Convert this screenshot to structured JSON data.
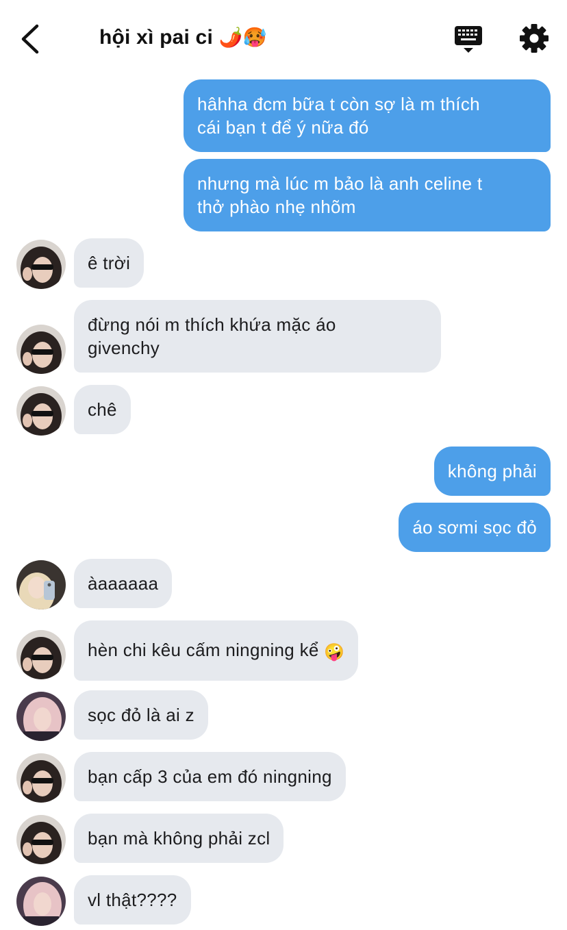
{
  "header": {
    "title": "hội xì pai ci",
    "title_emoji_1": "🌶️",
    "title_emoji_2": "🥵",
    "back_icon": "chevron-left-icon",
    "keyboard_icon": "keyboard-icon",
    "settings_icon": "gear-icon"
  },
  "colors": {
    "outgoing_bubble": "#4d9fe9",
    "incoming_bubble": "#e6e9ee",
    "header_text": "#111111"
  },
  "messages": [
    {
      "direction": "out",
      "lines": [
        "hâhha đcm bữa t còn sợ là m thích",
        "cái bạn t để ý nữa đó"
      ]
    },
    {
      "direction": "out",
      "lines": [
        "nhưng mà lúc m bảo là anh celine t",
        "thở phào nhẹ nhõm"
      ]
    },
    {
      "direction": "in",
      "avatar": "avatar-dark-hair-sunglasses",
      "lines": [
        "ê trời"
      ]
    },
    {
      "direction": "in",
      "avatar": "avatar-dark-hair-sunglasses",
      "lines": [
        "đừng nói m thích khứa mặc áo",
        "givenchy"
      ]
    },
    {
      "direction": "in",
      "avatar": "avatar-dark-hair-sunglasses",
      "lines": [
        "chê"
      ]
    },
    {
      "direction": "out",
      "lines": [
        "không phải"
      ]
    },
    {
      "direction": "out",
      "lines": [
        "áo sơmi sọc đỏ"
      ]
    },
    {
      "direction": "in",
      "avatar": "avatar-blonde-phone",
      "lines": [
        "àaaaaaa"
      ]
    },
    {
      "direction": "in",
      "avatar": "avatar-dark-hair-sunglasses",
      "lines": [
        "hèn chi kêu cấm ningning kể"
      ],
      "emoji": "🤪"
    },
    {
      "direction": "in",
      "avatar": "avatar-pink-hair",
      "lines": [
        "sọc đỏ là ai z"
      ]
    },
    {
      "direction": "in",
      "avatar": "avatar-dark-hair-sunglasses",
      "lines": [
        "bạn cấp 3 của em đó ningning"
      ]
    },
    {
      "direction": "in",
      "avatar": "avatar-dark-hair-sunglasses",
      "lines": [
        "bạn mà không phải zcl"
      ]
    },
    {
      "direction": "in",
      "avatar": "avatar-pink-hair",
      "lines": [
        "vl thật????"
      ]
    }
  ]
}
